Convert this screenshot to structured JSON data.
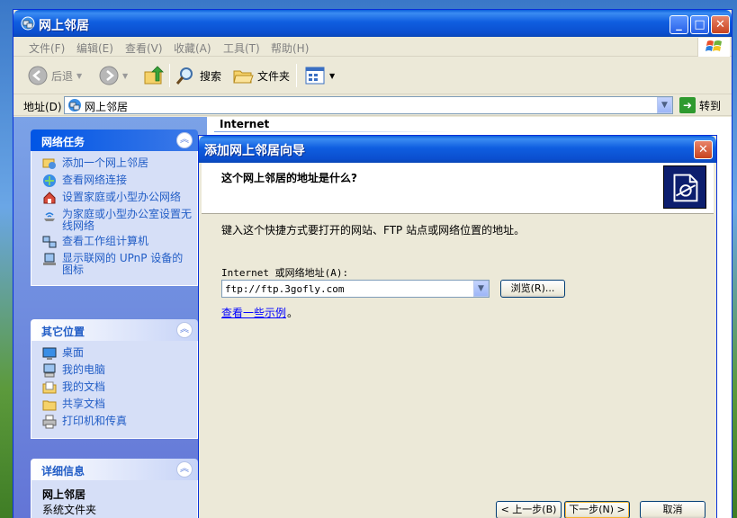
{
  "window": {
    "title": "网上邻居",
    "controls": {
      "minimize": "_",
      "maximize": "□",
      "close": "✕"
    }
  },
  "menu": [
    "文件(F)",
    "编辑(E)",
    "查看(V)",
    "收藏(A)",
    "工具(T)",
    "帮助(H)"
  ],
  "toolbar": {
    "back": "后退",
    "search": "搜索",
    "folders": "文件夹"
  },
  "address": {
    "label": "地址(D)",
    "value": "网上邻居",
    "go": "转到"
  },
  "panes": {
    "network_tasks": {
      "title": "网络任务",
      "items": [
        "添加一个网上邻居",
        "查看网络连接",
        "设置家庭或小型办公网络",
        "为家庭或小型办公室设置无线网络",
        "查看工作组计算机",
        "显示联网的 UPnP 设备的图标"
      ]
    },
    "other_places": {
      "title": "其它位置",
      "items": [
        "桌面",
        "我的电脑",
        "我的文档",
        "共享文档",
        "打印机和传真"
      ]
    },
    "details": {
      "title": "详细信息",
      "name": "网上邻居",
      "type": "系统文件夹"
    }
  },
  "content": {
    "group_header": "Internet"
  },
  "wizard": {
    "title": "添加网上邻居向导",
    "question": "这个网上邻居的地址是什么?",
    "description": "键入这个快捷方式要打开的网站、FTP 站点或网络位置的地址。",
    "field_label": "Internet 或网络地址(A):",
    "field_value": "ftp://ftp.3gofly.com",
    "browse": "浏览(R)...",
    "examples_link": "查看一些示例",
    "examples_dot": "。",
    "back_button": "< 上一步(B)",
    "next_button": "下一步(N) >",
    "cancel_button": "取消"
  }
}
